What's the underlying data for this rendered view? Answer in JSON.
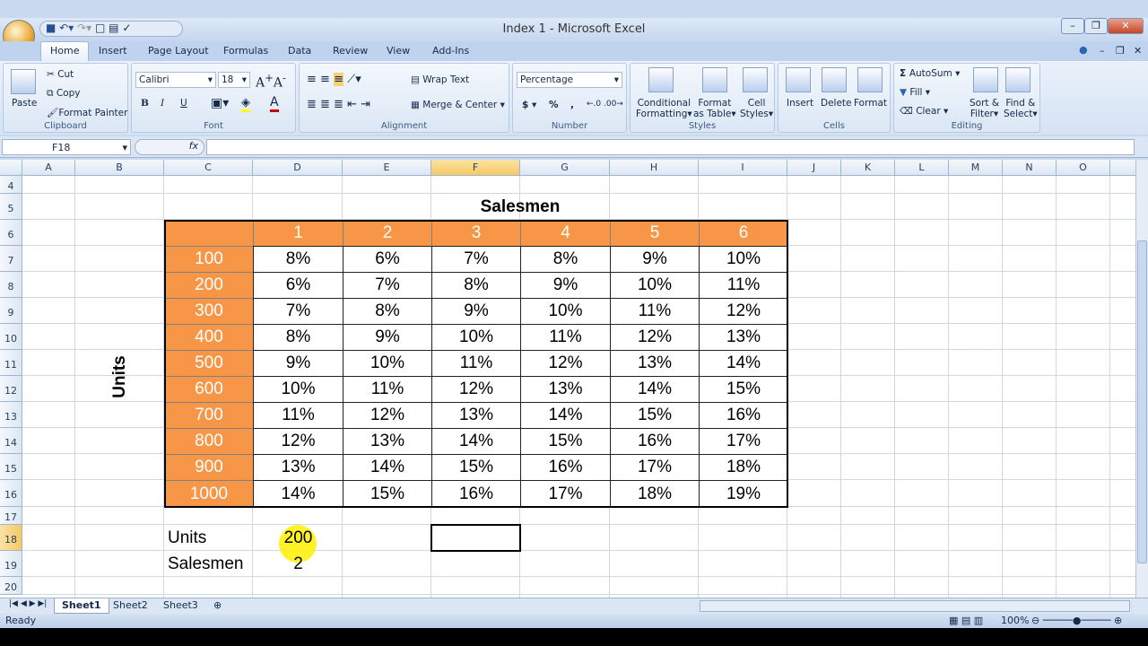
{
  "window": {
    "title": "Index 1 - Microsoft Excel"
  },
  "ribbon_tabs": [
    "Home",
    "Insert",
    "Page Layout",
    "Formulas",
    "Data",
    "Review",
    "View",
    "Add-Ins"
  ],
  "clipboard": {
    "paste": "Paste",
    "cut": "Cut",
    "copy": "Copy",
    "format_painter": "Format Painter",
    "label": "Clipboard"
  },
  "font": {
    "name": "Calibri",
    "size": "18",
    "bold": "B",
    "italic": "I",
    "underline": "U",
    "label": "Font"
  },
  "alignment": {
    "wrap": "Wrap Text",
    "merge": "Merge & Center",
    "label": "Alignment"
  },
  "number": {
    "format": "Percentage",
    "dollar": "$",
    "percent": "%",
    "comma": ",",
    "label": "Number"
  },
  "styles": {
    "conditional": [
      "Conditional",
      "Formatting"
    ],
    "format_table": [
      "Format",
      "as Table"
    ],
    "cell_styles": [
      "Cell",
      "Styles"
    ],
    "label": "Styles"
  },
  "cells": {
    "insert": "Insert",
    "delete": "Delete",
    "format": "Format",
    "label": "Cells"
  },
  "editing": {
    "autosum": "AutoSum",
    "fill": "Fill",
    "clear": "Clear",
    "sort": [
      "Sort &",
      "Filter"
    ],
    "find": [
      "Find &",
      "Select"
    ],
    "label": "Editing"
  },
  "formula_bar": {
    "name_box": "F18",
    "fx": "fx",
    "value": ""
  },
  "columns": [
    "A",
    "B",
    "C",
    "D",
    "E",
    "F",
    "G",
    "H",
    "I",
    "J",
    "K",
    "L",
    "M",
    "N",
    "O"
  ],
  "rows": [
    "4",
    "5",
    "6",
    "7",
    "8",
    "9",
    "10",
    "11",
    "12",
    "13",
    "14",
    "15",
    "16",
    "17",
    "18",
    "19",
    "20"
  ],
  "selected_cell": "F18",
  "table": {
    "title": "Salesmen",
    "side_label": "Units",
    "salesmen": [
      "1",
      "2",
      "3",
      "4",
      "5",
      "6"
    ],
    "units": [
      "100",
      "200",
      "300",
      "400",
      "500",
      "600",
      "700",
      "800",
      "900",
      "1000"
    ],
    "values": [
      [
        "8%",
        "6%",
        "7%",
        "8%",
        "9%",
        "10%"
      ],
      [
        "6%",
        "7%",
        "8%",
        "9%",
        "10%",
        "11%"
      ],
      [
        "7%",
        "8%",
        "9%",
        "10%",
        "11%",
        "12%"
      ],
      [
        "8%",
        "9%",
        "10%",
        "11%",
        "12%",
        "13%"
      ],
      [
        "9%",
        "10%",
        "11%",
        "12%",
        "13%",
        "14%"
      ],
      [
        "10%",
        "11%",
        "12%",
        "13%",
        "14%",
        "15%"
      ],
      [
        "11%",
        "12%",
        "13%",
        "14%",
        "15%",
        "16%"
      ],
      [
        "12%",
        "13%",
        "14%",
        "15%",
        "16%",
        "17%"
      ],
      [
        "13%",
        "14%",
        "15%",
        "16%",
        "17%",
        "18%"
      ],
      [
        "14%",
        "15%",
        "16%",
        "17%",
        "18%",
        "19%"
      ]
    ],
    "header_color": "#f79646"
  },
  "inputs": {
    "units_label": "Units",
    "units_value": "200",
    "salesmen_label": "Salesmen",
    "salesmen_value": "2"
  },
  "sheets": [
    "Sheet1",
    "Sheet2",
    "Sheet3"
  ],
  "status": {
    "text": "Ready",
    "zoom": "100%"
  }
}
